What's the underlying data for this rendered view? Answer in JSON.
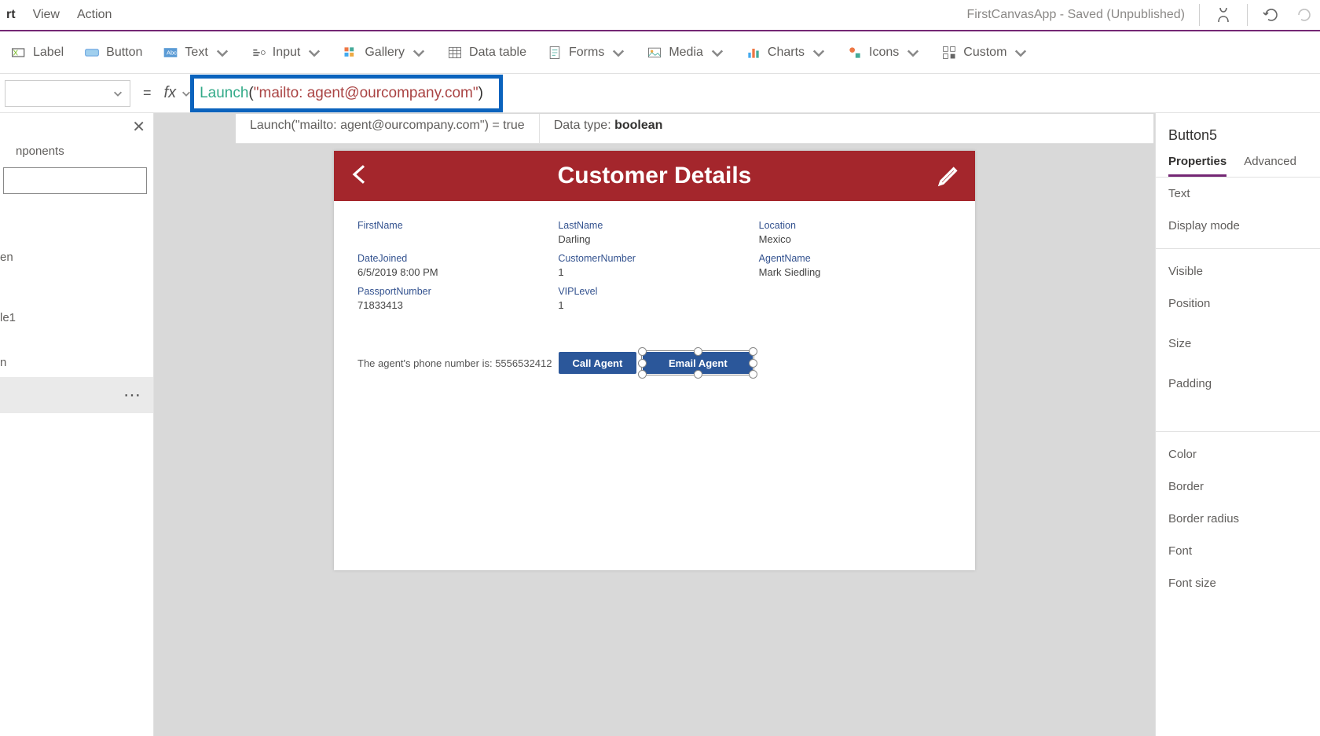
{
  "menubar": {
    "items": [
      "rt",
      "View",
      "Action"
    ],
    "app_status": "FirstCanvasApp - Saved (Unpublished)"
  },
  "ribbon": {
    "label": "Label",
    "button": "Button",
    "text": "Text",
    "input": "Input",
    "gallery": "Gallery",
    "datatable": "Data table",
    "forms": "Forms",
    "media": "Media",
    "charts": "Charts",
    "icons": "Icons",
    "custom": "Custom"
  },
  "property_selector": "",
  "fx_label": "fx",
  "formula": {
    "func": "Launch",
    "open": "(",
    "str": "\"mailto: agent@ourcompany.com\"",
    "close": ")"
  },
  "eval": {
    "expr": "Launch(\"mailto: agent@ourcompany.com\")  =  true",
    "dtype_label": "Data type: ",
    "dtype_value": "boolean"
  },
  "tree": {
    "tab1": "nponents",
    "items": [
      "",
      "",
      "en",
      "",
      "",
      "le1",
      "",
      "n",
      ""
    ]
  },
  "app": {
    "title": "Customer Details",
    "fields": [
      {
        "label": "FirstName",
        "value": ""
      },
      {
        "label": "LastName",
        "value": "Darling"
      },
      {
        "label": "Location",
        "value": "Mexico"
      },
      {
        "label": "DateJoined",
        "value": "6/5/2019 8:00 PM"
      },
      {
        "label": "CustomerNumber",
        "value": "1"
      },
      {
        "label": "AgentName",
        "value": "Mark Siedling"
      },
      {
        "label": "PassportNumber",
        "value": "71833413"
      },
      {
        "label": "VIPLevel",
        "value": "1"
      },
      {
        "label": "",
        "value": ""
      }
    ],
    "phone_label": "The agent's phone number is:  5556532412",
    "call_btn": "Call Agent",
    "email_btn": "Email Agent"
  },
  "props": {
    "selected": "Button5",
    "tab_props": "Properties",
    "tab_adv": "Advanced",
    "rows1": [
      "Text",
      "Display mode"
    ],
    "rows2": [
      "Visible",
      "Position",
      "Size",
      "Padding"
    ],
    "rows3": [
      "Color",
      "Border",
      "Border radius",
      "Font",
      "Font size"
    ]
  }
}
